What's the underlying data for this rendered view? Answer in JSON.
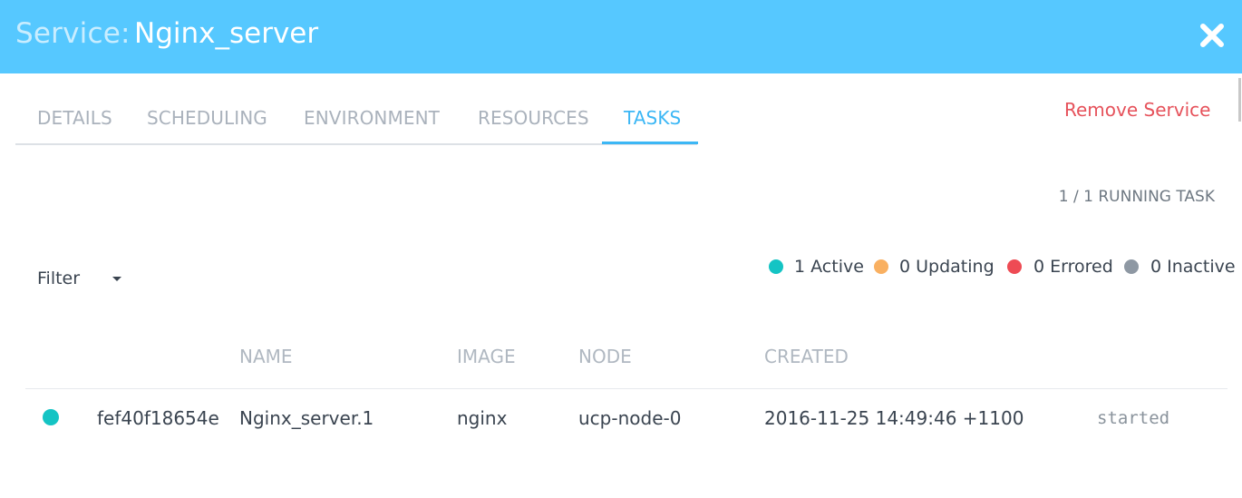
{
  "header": {
    "service_label": "Service:",
    "service_name": "Nginx_server",
    "close_icon": "close-icon"
  },
  "tabs": [
    {
      "label": "DETAILS",
      "active": false
    },
    {
      "label": "SCHEDULING",
      "active": false
    },
    {
      "label": "ENVIRONMENT",
      "active": false
    },
    {
      "label": "RESOURCES",
      "active": false
    },
    {
      "label": "TASKS",
      "active": true
    }
  ],
  "actions": {
    "remove_label": "Remove Service"
  },
  "summary": {
    "running": "1 / 1 RUNNING TASK"
  },
  "filter": {
    "label": "Filter"
  },
  "legend": [
    {
      "text": "1 Active",
      "color": "#14c4c4"
    },
    {
      "text": "0 Updating",
      "color": "#f9b061"
    },
    {
      "text": "0 Errored",
      "color": "#ee4b54"
    },
    {
      "text": "0 Inactive",
      "color": "#8e98a3"
    }
  ],
  "table": {
    "columns": [
      "NAME",
      "IMAGE",
      "NODE",
      "CREATED"
    ],
    "rows": [
      {
        "status_color": "#14c4c4",
        "id": "fef40f18654e",
        "name": "Nginx_server.1",
        "image": "nginx",
        "node": "ucp-node-0",
        "created": "2016-11-25 14:49:46 +1100",
        "state": "started"
      }
    ]
  },
  "colors": {
    "header_bg": "#56c8ff",
    "accent": "#3cb7f5",
    "danger": "#e6525b"
  }
}
